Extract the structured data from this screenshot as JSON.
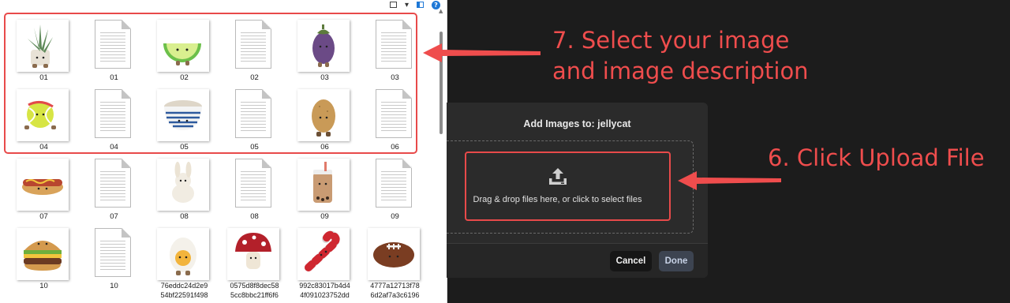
{
  "explorer": {
    "files": [
      {
        "name": "01",
        "type": "image",
        "plush": "plant-icon"
      },
      {
        "name": "01",
        "type": "text"
      },
      {
        "name": "02",
        "type": "image",
        "plush": "lime-icon"
      },
      {
        "name": "02",
        "type": "text"
      },
      {
        "name": "03",
        "type": "image",
        "plush": "eggplant-icon"
      },
      {
        "name": "03",
        "type": "text"
      },
      {
        "name": "04",
        "type": "image",
        "plush": "tennis-ball-icon"
      },
      {
        "name": "04",
        "type": "text"
      },
      {
        "name": "05",
        "type": "image",
        "plush": "bowl-icon"
      },
      {
        "name": "05",
        "type": "text"
      },
      {
        "name": "06",
        "type": "image",
        "plush": "potato-icon"
      },
      {
        "name": "06",
        "type": "text"
      },
      {
        "name": "07",
        "type": "image",
        "plush": "hotdog-icon"
      },
      {
        "name": "07",
        "type": "text"
      },
      {
        "name": "08",
        "type": "image",
        "plush": "bunny-icon"
      },
      {
        "name": "08",
        "type": "text"
      },
      {
        "name": "09",
        "type": "image",
        "plush": "boba-icon"
      },
      {
        "name": "09",
        "type": "text"
      },
      {
        "name": "10",
        "type": "image",
        "plush": "burger-icon"
      },
      {
        "name": "10",
        "type": "text"
      },
      {
        "name": "76eddc24d2e9\n54bf22591f498",
        "type": "image",
        "plush": "egg-icon"
      },
      {
        "name": "0575d8f8dec58\n5cc8bbc21ff6f6",
        "type": "image",
        "plush": "mushroom-icon"
      },
      {
        "name": "992c83017b4d4\n4f091023752dd",
        "type": "image",
        "plush": "candy-cane-icon"
      },
      {
        "name": "4777a12713f78\n6d2af7a3c6196",
        "type": "image",
        "plush": "football-icon"
      }
    ]
  },
  "modal": {
    "title": "Add Images to: jellycat",
    "dropzone_text": "Drag & drop files here, or click to select files",
    "cancel_label": "Cancel",
    "done_label": "Done"
  },
  "annotations": {
    "step7": "7. Select your image\nand image description",
    "step6": "6. Click Upload File",
    "color": "#ef4d4d"
  },
  "colors": {
    "background": "#1c1c1c",
    "modal": "#2b2b2b",
    "done_button": "#3d4451",
    "cancel_button": "#161616"
  }
}
